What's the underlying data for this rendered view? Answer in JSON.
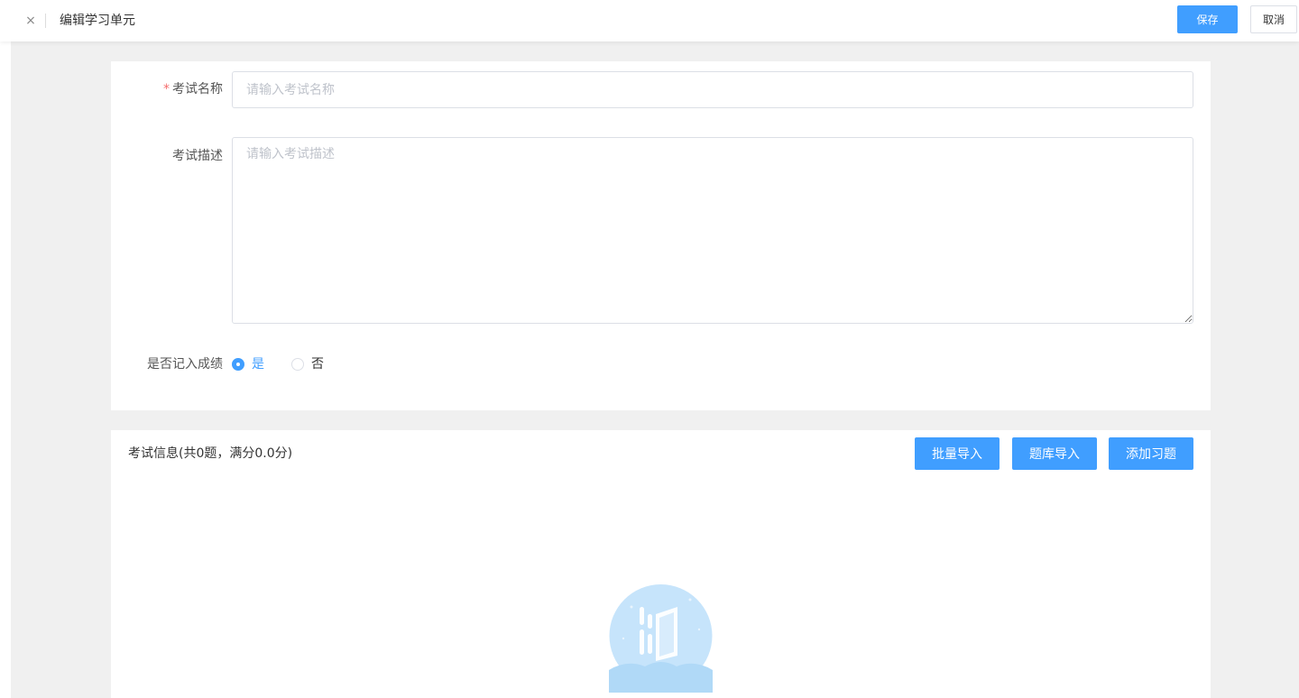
{
  "header": {
    "close_glyph": "×",
    "title": "编辑学习单元",
    "save_label": "保存",
    "cancel_label": "取消"
  },
  "form": {
    "exam_name": {
      "required_mark": "*",
      "label": "考试名称",
      "value": "",
      "placeholder": "请输入考试名称"
    },
    "exam_desc": {
      "label": "考试描述",
      "value": "",
      "placeholder": "请输入考试描述"
    },
    "record_score": {
      "label": "是否记入成绩",
      "options": [
        "是",
        "否"
      ],
      "selected": "是"
    }
  },
  "exam_info": {
    "title": "考试信息(共0题，满分0.0分)",
    "buttons": [
      "批量导入",
      "题库导入",
      "添加习题"
    ]
  },
  "icons": {
    "close": "close-icon",
    "empty": "empty-state-illustration"
  },
  "colors": {
    "primary": "#409eff",
    "required": "#f56c6c",
    "background": "#f0f0f0"
  }
}
